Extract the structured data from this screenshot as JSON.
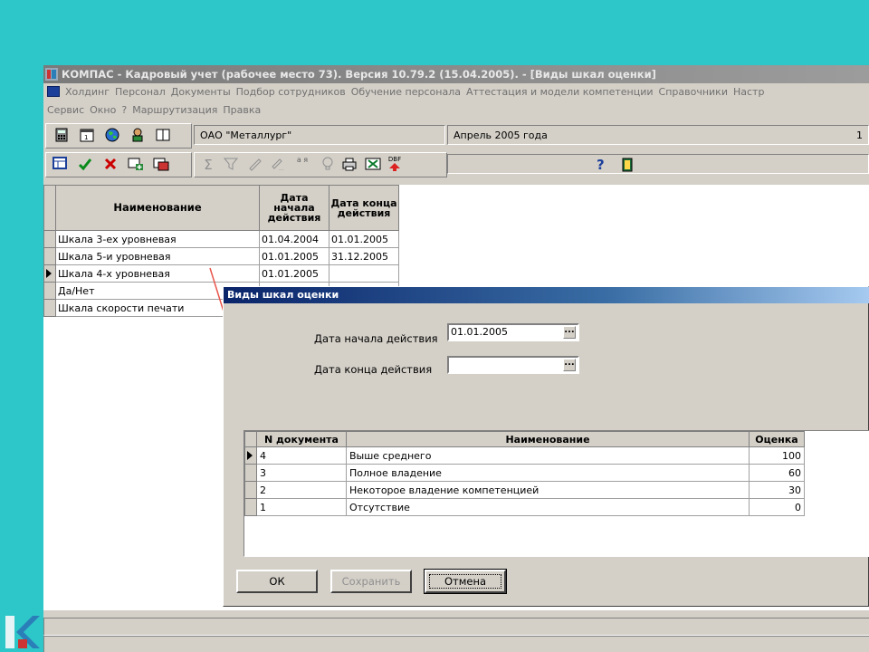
{
  "window": {
    "title": "КОМПАС - Кадровый учет (рабочее место 73). Версия 10.79.2 (15.04.2005). - [Виды шкал оценки]"
  },
  "menu": {
    "line1": [
      "Холдинг",
      "Персонал",
      "Документы",
      "Подбор сотрудников",
      "Обучение персонала",
      "Аттестация и модели компетенции",
      "Справочники",
      "Настр"
    ],
    "line2": [
      "Сервис",
      "Окно",
      "?",
      "Маршрутизация",
      "Правка"
    ]
  },
  "toolbar": {
    "org": "ОАО \"Металлург\"",
    "period": "Апрель 2005 года",
    "right_number": "1",
    "dbf_label": "DBF",
    "sort_label": "а я",
    "help_glyph": "?"
  },
  "main_grid": {
    "headers": [
      "Наименование",
      "Дата начала действия",
      "Дата конца действия"
    ],
    "rows": [
      {
        "name": "Шкала  3-ех уровневая",
        "start": "01.04.2004",
        "end": "01.01.2005"
      },
      {
        "name": "Шкала  5-и уровневая",
        "start": "01.01.2005",
        "end": "31.12.2005"
      },
      {
        "name": "Шкала 4-х уровневая",
        "start": "01.01.2005",
        "end": ""
      },
      {
        "name": "Да/Нет",
        "start": "",
        "end": ""
      },
      {
        "name": "Шкала скорости печати",
        "start": "",
        "end": ""
      }
    ],
    "current_row": 2
  },
  "dialog": {
    "title": "Виды шкал оценки",
    "start_label": "Дата начала действия",
    "start_value": "01.01.2005",
    "end_label": "Дата конца действия",
    "end_value": "",
    "grid_headers": [
      "N документа",
      "Наименование",
      "Оценка"
    ],
    "grid_rows": [
      {
        "doc": "4",
        "name": "Выше среднего",
        "score": "100"
      },
      {
        "doc": "3",
        "name": "Полное владение",
        "score": "60"
      },
      {
        "doc": "2",
        "name": "Некоторое владение компетенцией",
        "score": "30"
      },
      {
        "doc": "1",
        "name": "Отсутствие",
        "score": "0"
      }
    ],
    "ok_label": "ОК",
    "save_label": "Сохранить",
    "cancel_label": "Отмена"
  },
  "colors": {
    "background": "#2ec7c9",
    "dialog_title": "#0a246a",
    "annotation_arrow": "#e8534a"
  }
}
